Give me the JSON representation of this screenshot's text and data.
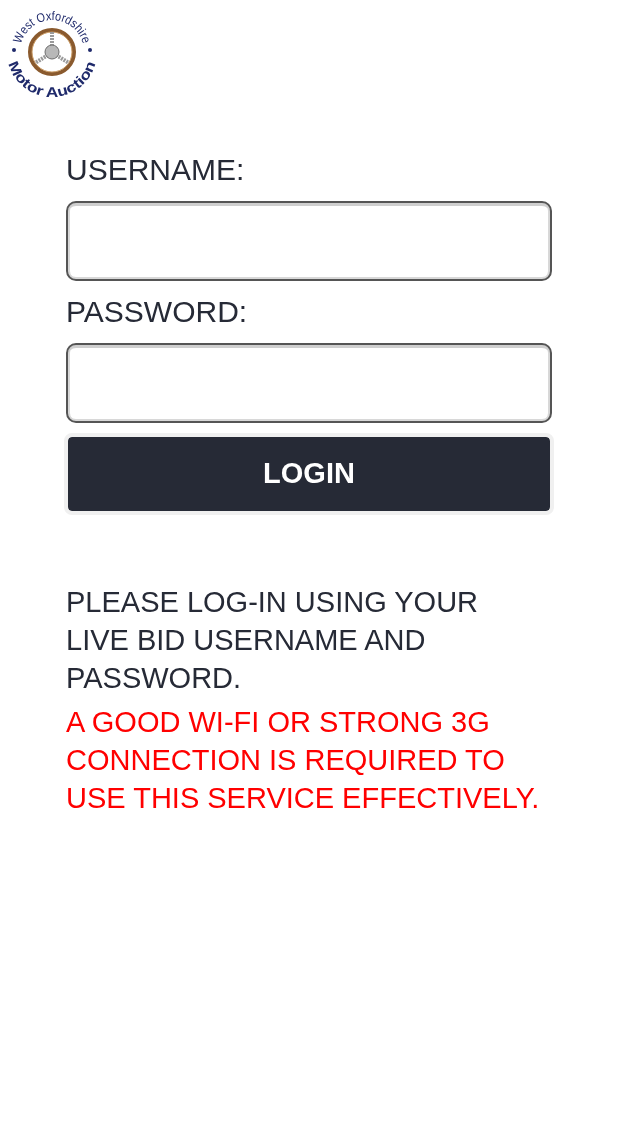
{
  "logo": {
    "top_text": "West Oxfordshire",
    "bottom_text": "Motor Auction"
  },
  "form": {
    "fields": [
      {
        "label": "USERNAME:"
      },
      {
        "label": "PASSWORD:"
      }
    ],
    "button": "LOGIN"
  },
  "notes": [
    {
      "kind": "info",
      "text": "PLEASE LOG-IN USING YOUR LIVE BID USERNAME AND PASSWORD."
    },
    {
      "kind": "warning",
      "text": "A GOOD WI-FI OR STRONG 3G CONNECTION IS REQUIRED TO USE THIS SERVICE EFFECTIVELY."
    }
  ]
}
